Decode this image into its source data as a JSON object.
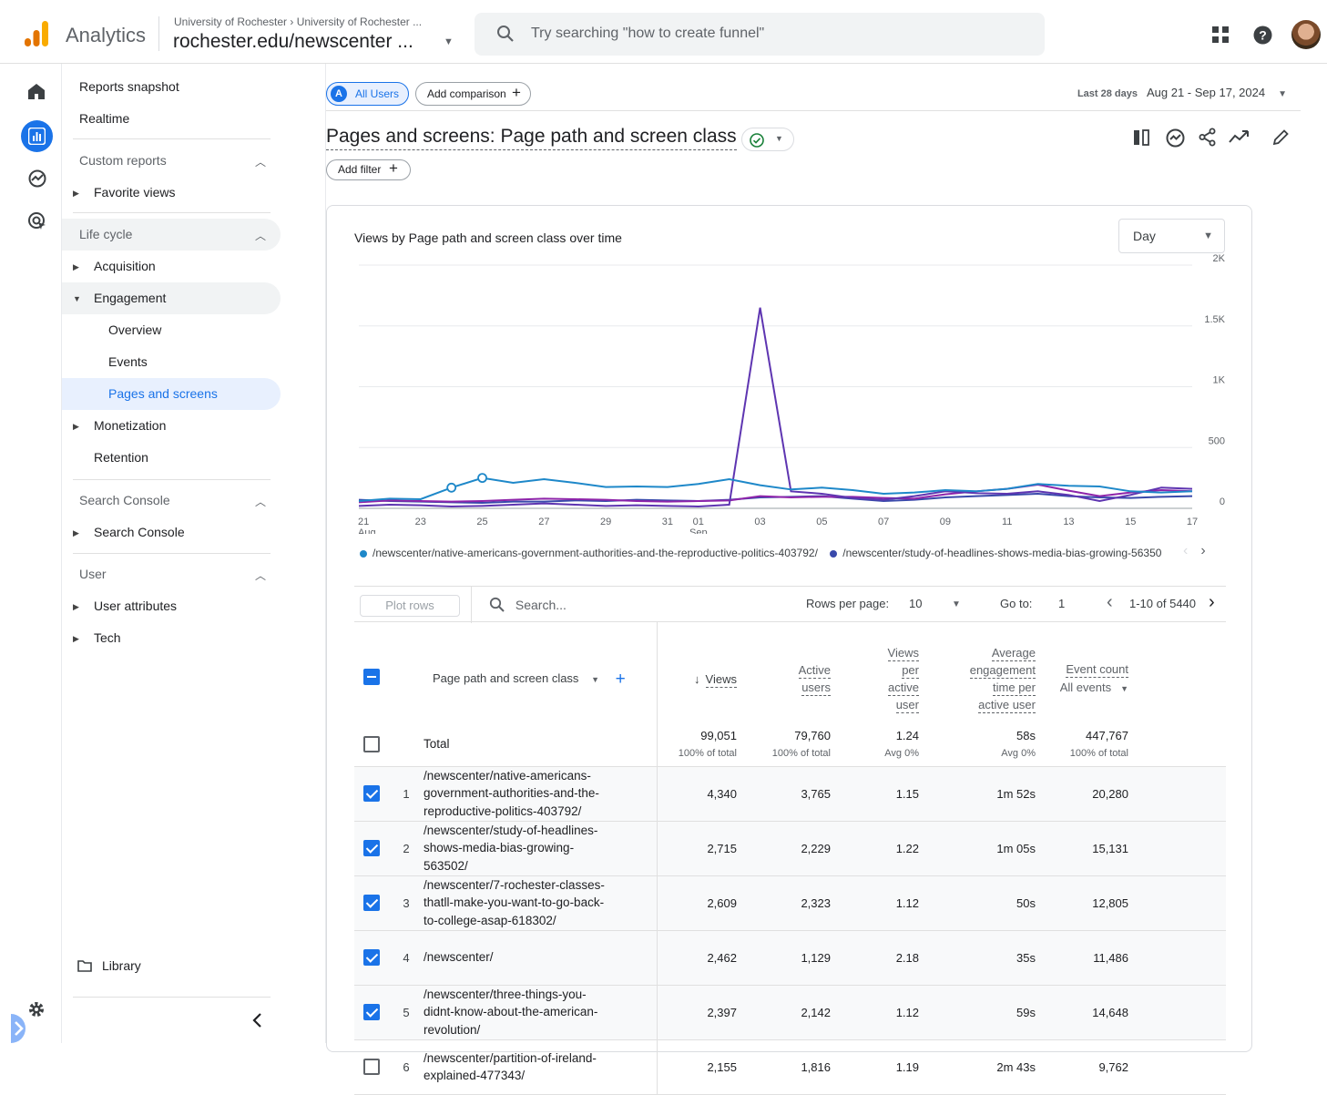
{
  "app": {
    "name": "Analytics"
  },
  "account": {
    "breadcrumb": "University of Rochester › University of Rochester ...",
    "property": "rochester.edu/newscenter ..."
  },
  "search": {
    "placeholder": "Try searching \"how to create funnel\""
  },
  "icons": {
    "apps": "apps-grid-icon",
    "help": "help-icon",
    "home": "home-icon",
    "reports": "reports-icon",
    "explore": "explore-icon",
    "advertising": "advertising-icon",
    "settings": "gear-icon"
  },
  "colors": {
    "accent": "#1a73e8",
    "series1": "#1e88c9",
    "series2": "#5e35b1",
    "series3": "#8e24aa",
    "series4": "#3949ab"
  },
  "nav": {
    "reports_snapshot": "Reports snapshot",
    "realtime": "Realtime",
    "custom_reports": "Custom reports",
    "favorite_views": "Favorite views",
    "life_cycle": "Life cycle",
    "acquisition": "Acquisition",
    "engagement": "Engagement",
    "overview": "Overview",
    "events": "Events",
    "pages_and_screens": "Pages and screens",
    "monetization": "Monetization",
    "retention": "Retention",
    "search_console_section": "Search Console",
    "search_console": "Search Console",
    "user_section": "User",
    "user_attributes": "User attributes",
    "tech": "Tech",
    "library": "Library"
  },
  "header": {
    "all_users": "All Users",
    "all_users_badge": "A",
    "add_comparison": "Add comparison",
    "date_label": "Last 28 days",
    "date_range": "Aug 21 - Sep 17, 2024",
    "title": "Pages and screens: Page path and screen class",
    "add_filter": "Add filter"
  },
  "card": {
    "title": "Views by Page path and screen class over time",
    "granularity": "Day"
  },
  "chart_data": {
    "type": "line",
    "title": "Views by Page path and screen class over time",
    "x": [
      "21 Aug",
      "22",
      "23",
      "24",
      "25",
      "26",
      "27",
      "28",
      "29",
      "30",
      "31",
      "01 Sep",
      "02",
      "03",
      "04",
      "05",
      "06",
      "07",
      "08",
      "09",
      "10",
      "11",
      "12",
      "13",
      "14",
      "15",
      "16",
      "17"
    ],
    "x_tick_labels": [
      "21",
      "23",
      "25",
      "27",
      "29",
      "31",
      "01",
      "03",
      "05",
      "07",
      "09",
      "11",
      "13",
      "15",
      "17"
    ],
    "x_tick_sublabels": {
      "21": "Aug",
      "01": "Sep"
    },
    "y_ticks": [
      "0",
      "500",
      "1K",
      "1.5K",
      "2K"
    ],
    "ylim": [
      0,
      2000
    ],
    "grid": true,
    "series": [
      {
        "name": "/newscenter/native-americans-government-authorities-and-the-reproductive-politics-403792/",
        "color": "#1e88c9",
        "values": [
          60,
          80,
          75,
          170,
          250,
          210,
          240,
          210,
          175,
          180,
          175,
          200,
          240,
          190,
          155,
          170,
          150,
          120,
          130,
          150,
          140,
          160,
          200,
          185,
          180,
          140,
          130,
          140
        ]
      },
      {
        "name": "/newscenter/study-of-headlines-shows-media-bias-growing-563502/",
        "color": "#5e35b1",
        "values": [
          20,
          30,
          25,
          15,
          20,
          30,
          40,
          30,
          20,
          25,
          20,
          15,
          30,
          1650,
          140,
          120,
          85,
          70,
          100,
          140,
          125,
          120,
          140,
          110,
          60,
          110,
          170,
          160
        ]
      },
      {
        "name": "",
        "color": "#8e24aa",
        "values": [
          50,
          65,
          60,
          55,
          60,
          70,
          80,
          75,
          70,
          60,
          55,
          60,
          65,
          100,
          90,
          95,
          95,
          85,
          80,
          115,
          140,
          160,
          195,
          145,
          100,
          130,
          150,
          140
        ]
      },
      {
        "name": "",
        "color": "#3949ab",
        "values": [
          70,
          60,
          55,
          50,
          45,
          55,
          55,
          65,
          60,
          70,
          65,
          60,
          70,
          90,
          95,
          100,
          80,
          60,
          70,
          90,
          100,
          110,
          120,
          100,
          90,
          85,
          95,
          100
        ]
      }
    ],
    "markers": [
      {
        "x": "24",
        "y": 170
      },
      {
        "x": "25",
        "y": 250
      }
    ]
  },
  "legend": {
    "item1": "/newscenter/native-americans-government-authorities-and-the-reproductive-politics-403792/",
    "item2": "/newscenter/study-of-headlines-shows-media-bias-growing-563502/"
  },
  "toolbar": {
    "plot_rows": "Plot rows",
    "search_placeholder": "Search...",
    "rows_per_page_label": "Rows per page:",
    "rows_per_page": "10",
    "go_to_label": "Go to:",
    "go_to": "1",
    "pagination": "1-10 of 5440"
  },
  "table": {
    "dimension_header": "Page path and screen class",
    "columns": [
      {
        "l1": "Views",
        "l2": "",
        "l3": "",
        "l4": ""
      },
      {
        "l1": "Active",
        "l2": "users",
        "l3": "",
        "l4": ""
      },
      {
        "l1": "Views",
        "l2": "per",
        "l3": "active",
        "l4": "user"
      },
      {
        "l1": "Average",
        "l2": "engagement",
        "l3": "time per",
        "l4": "active user"
      },
      {
        "l1": "Event count",
        "l2": "All events",
        "l3": "",
        "l4": ""
      }
    ],
    "total": {
      "label": "Total",
      "values": [
        "99,051",
        "79,760",
        "1.24",
        "58s",
        "447,767"
      ],
      "subs": [
        "100% of total",
        "100% of total",
        "Avg 0%",
        "Avg 0%",
        "100% of total"
      ]
    },
    "rows": [
      {
        "idx": "1",
        "l1": "/newscenter/native-americans-",
        "l2": "government-authorities-and-the-",
        "l3": "reproductive-politics-403792/",
        "v": [
          "4,340",
          "3,765",
          "1.15",
          "1m 52s",
          "20,280"
        ]
      },
      {
        "idx": "2",
        "l1": "/newscenter/study-of-headlines-",
        "l2": "shows-media-bias-growing-",
        "l3": "563502/",
        "v": [
          "2,715",
          "2,229",
          "1.22",
          "1m 05s",
          "15,131"
        ]
      },
      {
        "idx": "3",
        "l1": "/newscenter/7-rochester-classes-",
        "l2": "thatll-make-you-want-to-go-back-",
        "l3": "to-college-asap-618302/",
        "v": [
          "2,609",
          "2,323",
          "1.12",
          "50s",
          "12,805"
        ]
      },
      {
        "idx": "4",
        "l1": "/newscenter/",
        "l2": "",
        "l3": "",
        "v": [
          "2,462",
          "1,129",
          "2.18",
          "35s",
          "11,486"
        ]
      },
      {
        "idx": "5",
        "l1": "/newscenter/three-things-you-",
        "l2": "didnt-know-about-the-american-",
        "l3": "revolution/",
        "v": [
          "2,397",
          "2,142",
          "1.12",
          "59s",
          "14,648"
        ]
      },
      {
        "idx": "6",
        "l1": "/newscenter/partition-of-ireland-",
        "l2": "explained-477343/",
        "l3": "",
        "v": [
          "2,155",
          "1,816",
          "1.19",
          "2m 43s",
          "9,762"
        ]
      }
    ]
  }
}
